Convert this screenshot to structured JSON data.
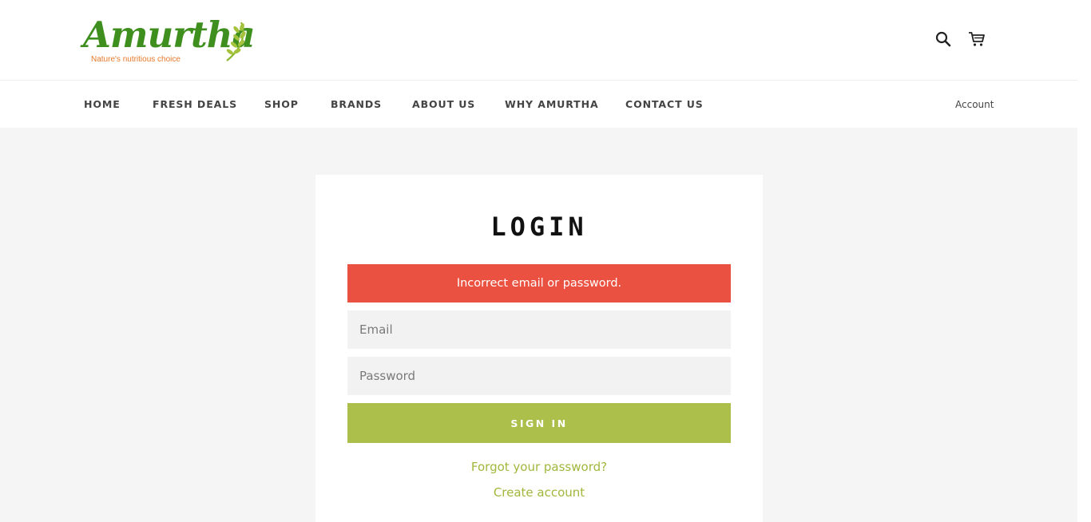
{
  "brand": {
    "logo_text": "Amurtha",
    "tagline": "Nature's nutritious choice",
    "logo_color": "#3f8f1f",
    "tagline_color": "#e8782a"
  },
  "header": {
    "icons": [
      "search-icon",
      "cart-icon"
    ]
  },
  "nav": {
    "items": [
      {
        "label": "HOME"
      },
      {
        "label": "FRESH DEALS"
      },
      {
        "label": "SHOP"
      },
      {
        "label": "BRANDS"
      },
      {
        "label": "ABOUT US"
      },
      {
        "label": "WHY AMURTHA"
      },
      {
        "label": "CONTACT US"
      }
    ],
    "account_label": "Account"
  },
  "login": {
    "title": "LOGIN",
    "error_message": "Incorrect email or password.",
    "email_placeholder": "Email",
    "email_value": "",
    "password_placeholder": "Password",
    "password_value": "",
    "sign_in_label": "SIGN IN",
    "forgot_label": "Forgot your password?",
    "create_label": "Create account"
  },
  "colors": {
    "accent": "#abbf4a",
    "link": "#a0b73c",
    "error": "#eb5140",
    "background": "#f5f5f5"
  }
}
